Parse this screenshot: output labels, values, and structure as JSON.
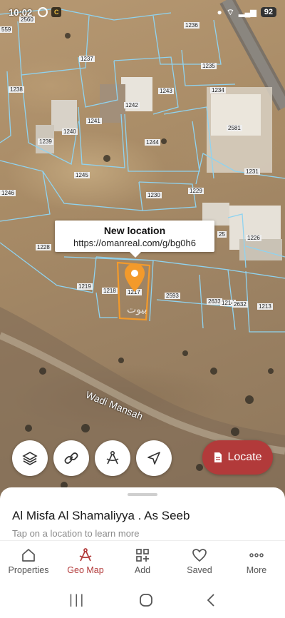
{
  "status_bar": {
    "time": "10:02",
    "battery": "92"
  },
  "map": {
    "parcel_labels": [
      "2560",
      "559",
      "1236",
      "1237",
      "1235",
      "1238",
      "1243",
      "1234",
      "1242",
      "2581",
      "1240",
      "1241",
      "1239",
      "1244",
      "1231",
      "1245",
      "1229",
      "1246",
      "1230",
      "1226",
      "1228",
      "25",
      "1219",
      "1218",
      "1217",
      "2593",
      "2633",
      "1214",
      "2632",
      "1213"
    ],
    "area_label": "Wadi Mansah",
    "watermark": "بيوت"
  },
  "tooltip": {
    "title": "New location",
    "url": "https://omanreal.com/g/bg0h6"
  },
  "controls": {
    "locate_label": "Locate"
  },
  "sheet": {
    "place_name": "Al Misfa Al Shamaliyya . As Seeb",
    "hint": "Tap on a location to learn more"
  },
  "nav": {
    "items": [
      {
        "label": "Properties",
        "icon": "home-icon"
      },
      {
        "label": "Geo Map",
        "icon": "geo-map-icon",
        "active": true
      },
      {
        "label": "Add",
        "icon": "add-grid-icon"
      },
      {
        "label": "Saved",
        "icon": "heart-icon"
      },
      {
        "label": "More",
        "icon": "more-dots-icon"
      }
    ]
  },
  "colors": {
    "accent": "#b23a3a",
    "parcel_line": "#8fd3f0",
    "selected_parcel": "#f39a2b"
  }
}
